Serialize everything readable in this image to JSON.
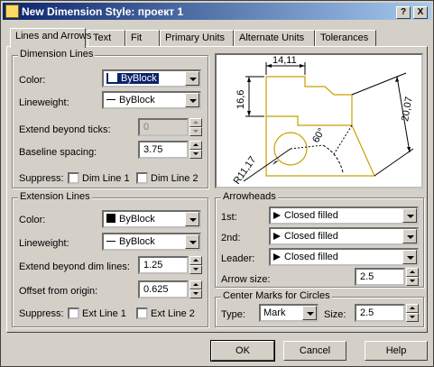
{
  "window": {
    "title": "New Dimension Style: проект 1",
    "help_btn": "?",
    "close_btn": "X"
  },
  "tabs": [
    {
      "label": "Lines and Arrows",
      "active": true
    },
    {
      "label": "Text"
    },
    {
      "label": "Fit"
    },
    {
      "label": "Primary Units"
    },
    {
      "label": "Alternate Units"
    },
    {
      "label": "Tolerances"
    }
  ],
  "dim_lines": {
    "title": "Dimension Lines",
    "color_label": "Color:",
    "color_value": "ByBlock",
    "lineweight_label": "Lineweight:",
    "lineweight_value": "ByBlock",
    "extend_label": "Extend beyond ticks:",
    "extend_value": "0",
    "baseline_label": "Baseline spacing:",
    "baseline_value": "3.75",
    "suppress_label": "Suppress:",
    "dim_line1": "Dim Line 1",
    "dim_line2": "Dim Line 2"
  },
  "ext_lines": {
    "title": "Extension Lines",
    "color_label": "Color:",
    "color_value": "ByBlock",
    "lineweight_label": "Lineweight:",
    "lineweight_value": "ByBlock",
    "extend_label": "Extend beyond dim lines:",
    "extend_value": "1.25",
    "offset_label": "Offset from origin:",
    "offset_value": "0.625",
    "suppress_label": "Suppress:",
    "ext_line1": "Ext Line 1",
    "ext_line2": "Ext Line 2"
  },
  "preview": {
    "dim_top": "14,11",
    "dim_left": "16,6",
    "dim_right": "20,07",
    "dim_angle": "60°",
    "dim_radius": "R11,17",
    "outline_color": "#c8a000"
  },
  "arrowheads": {
    "title": "Arrowheads",
    "first_label": "1st:",
    "first_value": "Closed filled",
    "second_label": "2nd:",
    "second_value": "Closed filled",
    "leader_label": "Leader:",
    "leader_value": "Closed filled",
    "size_label": "Arrow size:",
    "size_value": "2.5"
  },
  "center_marks": {
    "title": "Center Marks for Circles",
    "type_label": "Type:",
    "type_value": "Mark",
    "size_label": "Size:",
    "size_value": "2.5"
  },
  "buttons": {
    "ok": "OK",
    "cancel": "Cancel",
    "help": "Help"
  }
}
